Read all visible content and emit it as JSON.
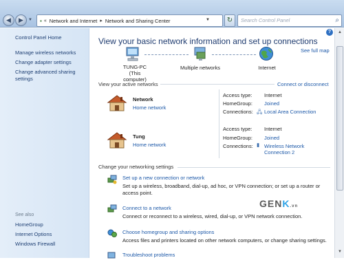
{
  "address": {
    "crumbs": [
      "Network and Internet",
      "Network and Sharing Center"
    ]
  },
  "search": {
    "placeholder": "Search Control Panel"
  },
  "sidebar": {
    "home": "Control Panel Home",
    "items": [
      {
        "label": "Manage wireless networks"
      },
      {
        "label": "Change adapter settings"
      },
      {
        "label": "Change advanced sharing"
      },
      {
        "label": "settings"
      }
    ],
    "see_also": "See also",
    "see_also_items": [
      {
        "label": "HomeGroup"
      },
      {
        "label": "Internet Options"
      },
      {
        "label": "Windows Firewall"
      }
    ]
  },
  "main": {
    "heading": "View your basic network information and set up connections",
    "see_full_map": "See full map",
    "nodes": [
      {
        "label": "TUNG-PC",
        "sublabel": "(This computer)"
      },
      {
        "label": "Multiple networks"
      },
      {
        "label": "Internet"
      }
    ],
    "active_label": "View your active networks",
    "connect_link": "Connect or disconnect",
    "networks": [
      {
        "name": "Network",
        "type_link": "Home network",
        "access_type_label": "Access type:",
        "access_type": "Internet",
        "homegroup_label": "HomeGroup:",
        "homegroup": "Joined",
        "connections_label": "Connections:",
        "connection": "Local Area Connection",
        "connection2": ""
      },
      {
        "name": "Tung",
        "type_link": "Home network",
        "access_type_label": "Access type:",
        "access_type": "Internet",
        "homegroup_label": "HomeGroup:",
        "homegroup": "Joined",
        "connections_label": "Connections:",
        "connection": "Wireless Network",
        "connection2": "Connection 2"
      }
    ],
    "change_label": "Change your networking settings",
    "tasks": [
      {
        "title": "Set up a new connection or network",
        "desc1": "Set up a wireless, broadband, dial-up, ad hoc, or VPN connection; or set up a router or",
        "desc2": "access point."
      },
      {
        "title": "Connect to a network",
        "desc1": "Connect or reconnect to a wireless, wired, dial-up, or VPN network connection.",
        "desc2": ""
      },
      {
        "title": "Choose homegroup and sharing options",
        "desc1": "Access files and printers located on other network computers, or change sharing settings.",
        "desc2": ""
      },
      {
        "title": "Troubleshoot problems",
        "desc1": "",
        "desc2": ""
      }
    ]
  },
  "watermark": {
    "main": "GEN",
    "accent": "K",
    "suffix": ".vn"
  },
  "colors": {
    "link": "#1c58a8",
    "heading": "#1e3b6f",
    "sidebar": "#dce9f7"
  }
}
